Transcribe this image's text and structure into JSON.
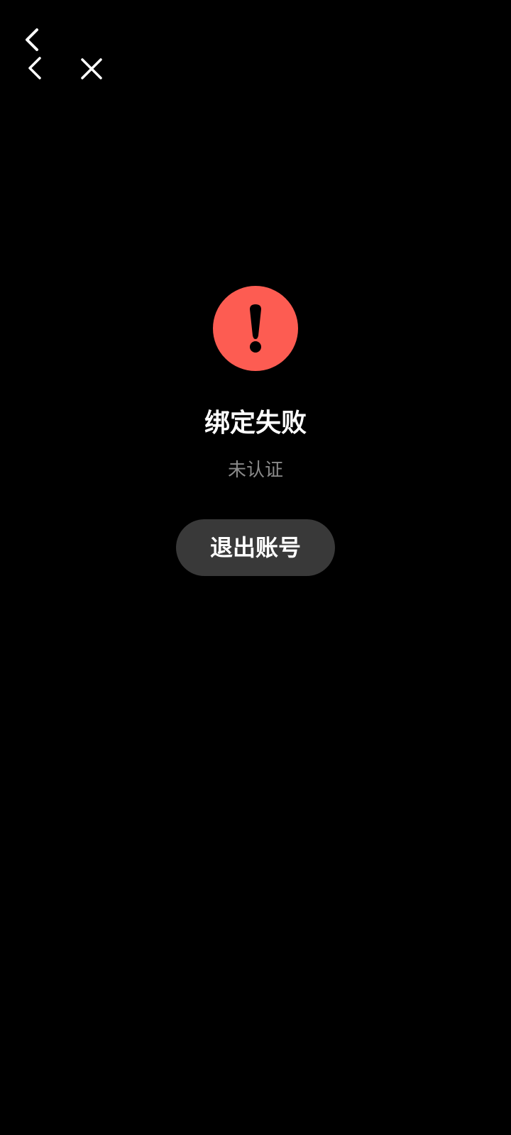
{
  "nav": {
    "status_back_icon": "chevron-left-icon",
    "back_icon": "chevron-left-icon",
    "close_icon": "close-icon"
  },
  "result": {
    "icon": "alert-exclamation-icon",
    "title": "绑定失败",
    "subtitle": "未认证",
    "action_label": "退出账号"
  },
  "colors": {
    "background": "#000000",
    "error_red": "#FD5C52",
    "subtitle_gray": "#8A8A8A",
    "button_bg": "#393939",
    "text_white": "#FFFFFF"
  }
}
